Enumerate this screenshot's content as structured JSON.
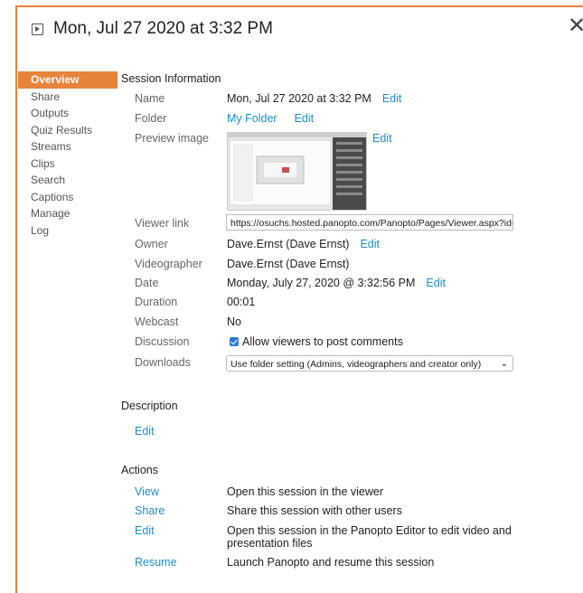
{
  "title": "Mon, Jul 27 2020 at 3:32 PM",
  "sidebar": {
    "items": [
      {
        "label": "Overview"
      },
      {
        "label": "Share"
      },
      {
        "label": "Outputs"
      },
      {
        "label": "Quiz Results"
      },
      {
        "label": "Streams"
      },
      {
        "label": "Clips"
      },
      {
        "label": "Search"
      },
      {
        "label": "Captions"
      },
      {
        "label": "Manage"
      },
      {
        "label": "Log"
      }
    ],
    "active": "Overview"
  },
  "session": {
    "heading": "Session Information",
    "name_label": "Name",
    "name_value": "Mon, Jul 27 2020 at 3:32 PM",
    "folder_label": "Folder",
    "folder_value": "My Folder",
    "preview_label": "Preview image",
    "viewer_label": "Viewer link",
    "viewer_url": "https://osuchs.hosted.panopto.com/Panopto/Pages/Viewer.aspx?id=",
    "owner_label": "Owner",
    "owner_value": "Dave.Ernst (Dave Ernst)",
    "videographer_label": "Videographer",
    "videographer_value": "Dave.Ernst (Dave Ernst)",
    "date_label": "Date",
    "date_value": "Monday, July 27, 2020 @ 3:32:56 PM",
    "duration_label": "Duration",
    "duration_value": "00:01",
    "webcast_label": "Webcast",
    "webcast_value": "No",
    "discussion_label": "Discussion",
    "discussion_value": "Allow viewers to post comments",
    "discussion_checked": true,
    "downloads_label": "Downloads",
    "downloads_value": "Use folder setting (Admins, videographers and creator only)",
    "edit_label": "Edit"
  },
  "description": {
    "heading": "Description",
    "edit_label": "Edit"
  },
  "actions": {
    "heading": "Actions",
    "items": [
      {
        "link": "View",
        "desc": "Open this session in the viewer"
      },
      {
        "link": "Share",
        "desc": "Share this session with other users"
      },
      {
        "link": "Edit",
        "desc": "Open this session in the Panopto Editor to edit video and presentation files"
      },
      {
        "link": "Resume",
        "desc": "Launch Panopto and resume this session"
      }
    ]
  },
  "colors": {
    "accent": "#e8833a",
    "link": "#1a8fc9",
    "checkbox": "#2d7dd2"
  }
}
